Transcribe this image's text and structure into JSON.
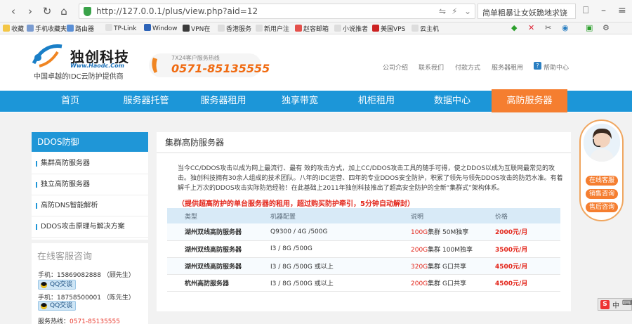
{
  "browser": {
    "url": "http://127.0.0.1/plus/view.php?aid=12",
    "search_text": "简单粗暴让女妖跪地求饶"
  },
  "bookmarks": [
    "收藏",
    "手机收藏夹",
    "路由器",
    "TP-Link",
    "Window",
    "VPN在",
    "香港服务",
    "新用户注",
    "赵容邮箱",
    "小说推者",
    "美国VPS",
    "云主机"
  ],
  "header": {
    "logo_name": "独创科技",
    "logo_url": "Www.Haodc.Com",
    "slogan": "中国卓越的IDC云防护提供商",
    "hotline_label": "7X24客户服务热线",
    "hotline_number": "0571-85135555",
    "top_links": [
      "公司介绍",
      "联系我们",
      "付款方式",
      "服务器租用",
      "帮助中心"
    ]
  },
  "nav": [
    "首页",
    "服务器托管",
    "服务器租用",
    "独享带宽",
    "机柜租用",
    "数据中心",
    "高防服务器"
  ],
  "sidebar": {
    "title": "DDOS防御",
    "items": [
      "集群高防服务器",
      "独立高防服务器",
      "高防DNS智能解析",
      "DDOS攻击原理与解决方案"
    ]
  },
  "service": {
    "title": "在线客服咨询",
    "contacts": [
      {
        "label": "手机：15869082888 （顾先生）",
        "qq": "QQ交谈"
      },
      {
        "label": "手机：18758500001 （陈先生）",
        "qq": "QQ交谈"
      }
    ],
    "hotline_label": "服务热线：",
    "hotline_number": "0571-85135555"
  },
  "main": {
    "title": "集群高防服务器",
    "description": "当今CC/DDOS攻击以成为网上最流行、最有 效的攻击方式，加上CC/DDOS攻击工具的随手可得，使之DDOS以成为互联网最常见的攻击。独创科技拥有30余人组成的技术团队。八年的IDC运营、四年的专业DDOS安全防护，积累了领先与领先DDOS攻击的防范水准。有着解千上万次的DDOS攻击实际防范经验！在此基础上2011年独创科技推出了超高安全防护的全新“集群式”架构体系。",
    "promo": "（提供超高防护的单台服务器的租用，超过购买防护牵引，5分钟自动解封）",
    "table": {
      "headers": [
        "类型",
        "机器配置",
        "说明",
        "价格"
      ],
      "rows": [
        {
          "type": "湖州双线高防服务器",
          "config": "Q9300 / 4G /500G",
          "desc_hl": "100G",
          "desc": "集群 50M独享",
          "price": "2000元/月"
        },
        {
          "type": "湖州双线高防服务器",
          "config": "I3 / 8G /500G",
          "desc_hl": "200G",
          "desc": "集群 100M独享",
          "price": "3500元/月"
        },
        {
          "type": "湖州双线高防服务器",
          "config": "I3 / 8G /500G 或以上",
          "desc_hl": "320G",
          "desc": "集群 G口共享",
          "price": "4500元/月"
        },
        {
          "type": "杭州高防服务器",
          "config": "I3 / 8G /500G 或以上",
          "desc_hl": "200G",
          "desc": "集群 G口共享",
          "price": "4500元/月"
        }
      ]
    }
  },
  "float_widget": {
    "buttons": [
      "在线客服",
      "销售咨询",
      "售后咨询"
    ]
  },
  "colors": {
    "nav_blue": "#1c96d8",
    "nav_active": "#f57e30",
    "accent_red": "#e3261b"
  }
}
